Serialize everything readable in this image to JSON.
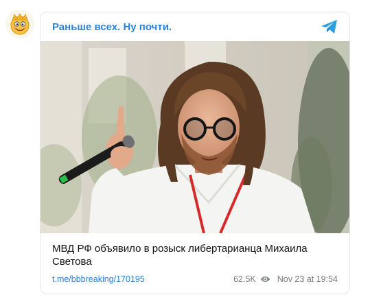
{
  "channel": {
    "name": "Раньше всех. Ну почти.",
    "avatar_icon": "cartoon-face-icon",
    "platform_icon": "telegram-icon",
    "accent_color": "#2b82d9"
  },
  "post": {
    "text": "МВД РФ объявило в розыск либертарианца Михаила Светова",
    "image_icon": "photo-man-with-microphone",
    "link": "t.me/bbbreaking/170195",
    "views": "62.5K",
    "views_icon": "eye-icon",
    "date": "Nov 23 at 19:54"
  }
}
